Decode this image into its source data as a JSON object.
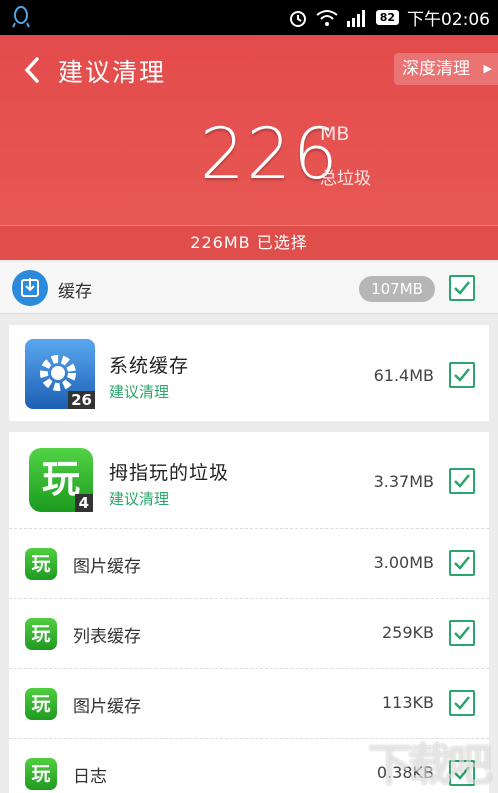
{
  "status_bar": {
    "time": "下午02:06",
    "battery": "82"
  },
  "header": {
    "title": "建议清理",
    "deep_clean": "深度清理",
    "total_value": "226",
    "total_unit": "MB",
    "total_label": "总垃圾",
    "selected": "226MB  已选择"
  },
  "cache_row": {
    "label": "缓存",
    "size": "107MB"
  },
  "apps": [
    {
      "name": "系统缓存",
      "tag": "建议清理",
      "size": "61.4MB",
      "badge": "26"
    },
    {
      "name": "拇指玩的垃圾",
      "tag": "建议清理",
      "size": "3.37MB",
      "badge": "4",
      "icon_char": "玩"
    }
  ],
  "sub_items": [
    {
      "label": "图片缓存",
      "size": "3.00MB"
    },
    {
      "label": "列表缓存",
      "size": "259KB"
    },
    {
      "label": "图片缓存",
      "size": "113KB"
    },
    {
      "label": "日志",
      "size": "0.38KB"
    }
  ],
  "watermark": "下载吧",
  "colors": {
    "header": "#e34b4b",
    "accent_green": "#2aa56b",
    "blue": "#2b8ad9"
  }
}
